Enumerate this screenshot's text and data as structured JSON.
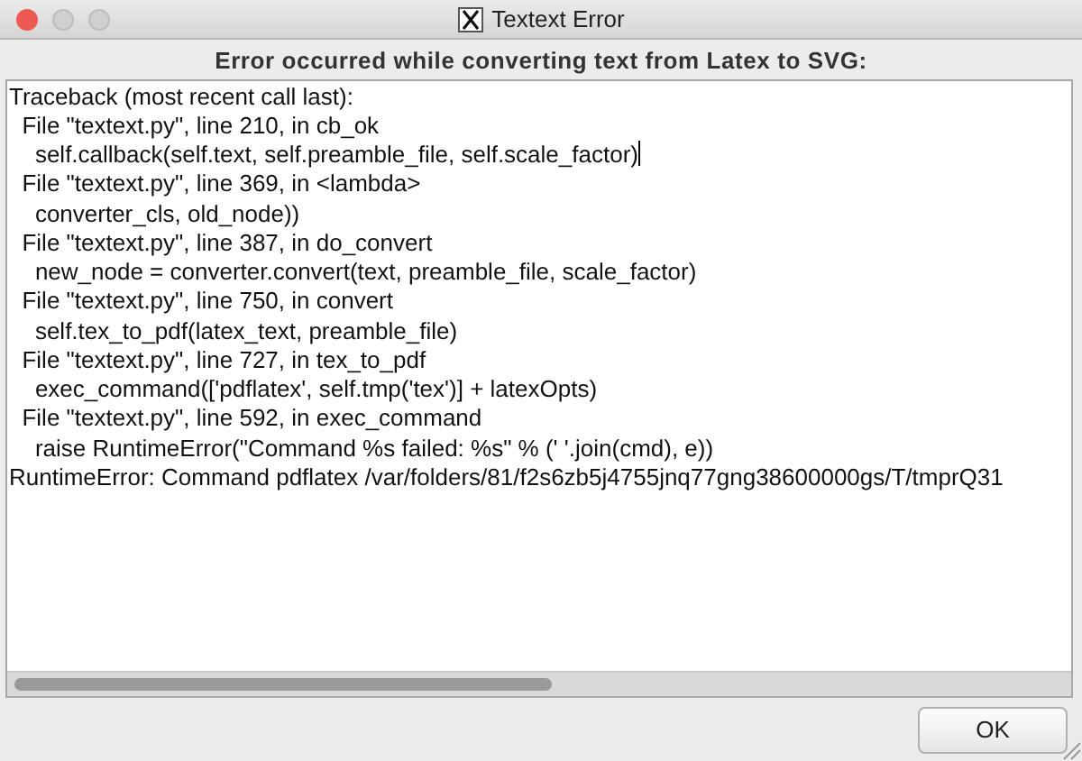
{
  "window": {
    "title": "Textext Error"
  },
  "heading": "Error occurred while converting text from Latex to SVG:",
  "traceback": [
    "Traceback (most recent call last):",
    "  File \"textext.py\", line 210, in cb_ok",
    "    self.callback(self.text, self.preamble_file, self.scale_factor)",
    "  File \"textext.py\", line 369, in <lambda>",
    "    converter_cls, old_node))",
    "  File \"textext.py\", line 387, in do_convert",
    "    new_node = converter.convert(text, preamble_file, scale_factor)",
    "  File \"textext.py\", line 750, in convert",
    "    self.tex_to_pdf(latex_text, preamble_file)",
    "  File \"textext.py\", line 727, in tex_to_pdf",
    "    exec_command(['pdflatex', self.tmp('tex')] + latexOpts)",
    "  File \"textext.py\", line 592, in exec_command",
    "    raise RuntimeError(\"Command %s failed: %s\" % (' '.join(cmd), e))",
    "RuntimeError: Command pdflatex /var/folders/81/f2s6zb5j4755jnq77gng38600000gs/T/tmprQ31"
  ],
  "buttons": [
    {
      "label": "OK"
    }
  ]
}
